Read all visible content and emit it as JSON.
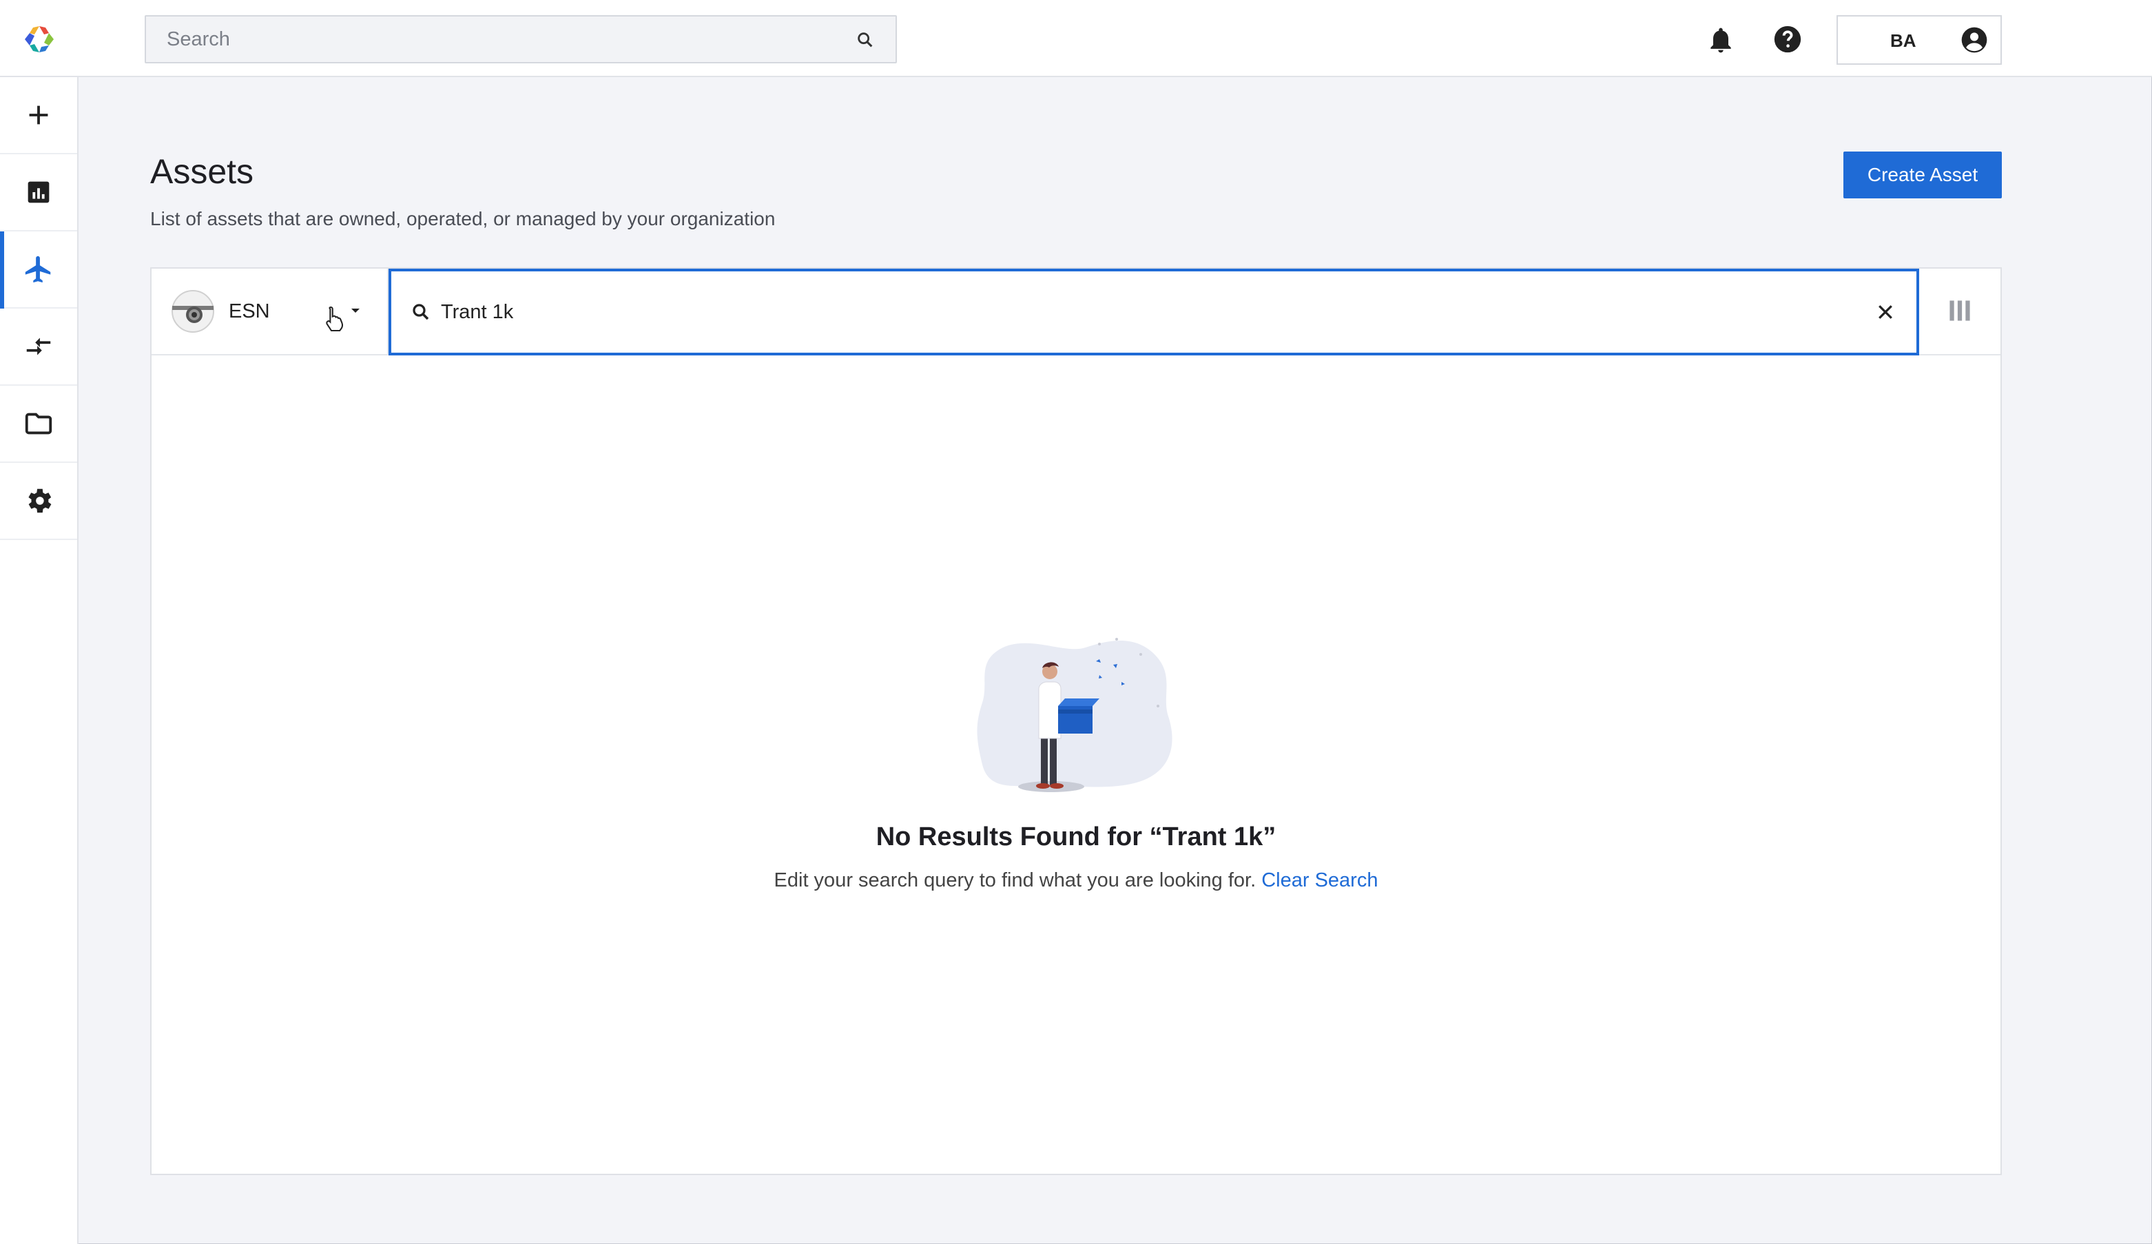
{
  "header": {
    "search_placeholder": "Search",
    "user_initials": "BA"
  },
  "sidebar": {
    "items": [
      {
        "icon": "plus-icon",
        "active": false
      },
      {
        "icon": "bar-chart-icon",
        "active": false
      },
      {
        "icon": "airplane-icon",
        "active": true
      },
      {
        "icon": "transfer-arrows-icon",
        "active": false
      },
      {
        "icon": "folder-icon",
        "active": false
      },
      {
        "icon": "gear-icon",
        "active": false
      }
    ]
  },
  "main": {
    "title": "Assets",
    "subtitle": "List of assets that are owned, operated, or managed by your organization",
    "create_button": "Create Asset",
    "field_selector": "ESN",
    "search_value": "Trant 1k",
    "empty_title": "No Results Found for “Trant 1k”",
    "empty_text": "Edit your search query to find what you are looking for.",
    "clear_search": "Clear Search"
  },
  "colors": {
    "accent": "#1f6bd6",
    "background": "#f3f4f8"
  }
}
